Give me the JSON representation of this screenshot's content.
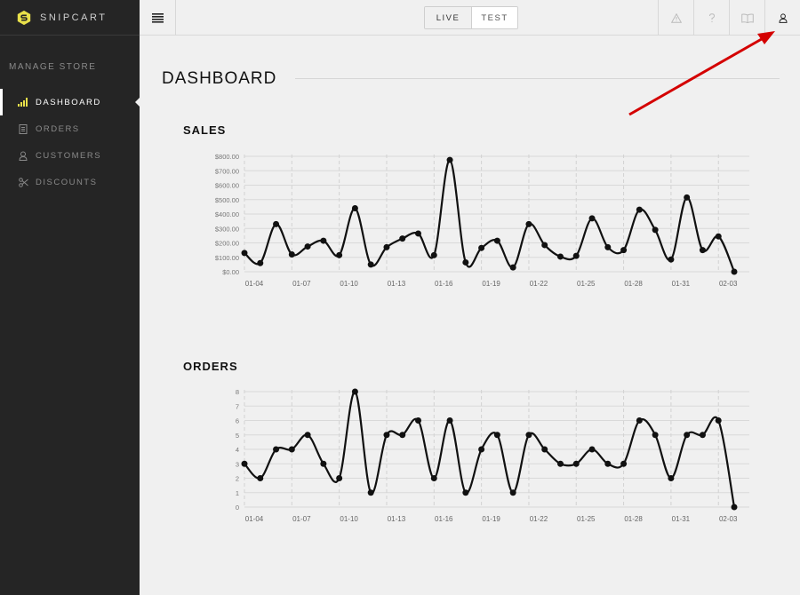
{
  "brand": {
    "name": "SNIPCART"
  },
  "sidebar": {
    "section_title": "MANAGE STORE",
    "items": [
      {
        "label": "DASHBOARD",
        "icon": "bar-chart-icon",
        "active": true
      },
      {
        "label": "ORDERS",
        "icon": "document-icon",
        "active": false
      },
      {
        "label": "CUSTOMERS",
        "icon": "user-icon",
        "active": false
      },
      {
        "label": "DISCOUNTS",
        "icon": "scissors-icon",
        "active": false
      }
    ]
  },
  "topbar": {
    "env_options": [
      "LIVE",
      "TEST"
    ],
    "env_selected": "TEST",
    "icons": [
      "warning-icon",
      "help-icon",
      "book-icon",
      "user-icon"
    ]
  },
  "page": {
    "title": "DASHBOARD"
  },
  "colors": {
    "sidebar_bg": "#252525",
    "accent": "#e8e04a",
    "annotation_arrow": "#d40000"
  },
  "chart_data": [
    {
      "type": "line",
      "title": "SALES",
      "x_ticks": [
        "01-04",
        "01-07",
        "01-10",
        "01-13",
        "01-16",
        "01-19",
        "01-22",
        "01-25",
        "01-28",
        "01-31",
        "02-03"
      ],
      "y_ticks": [
        "$0.00",
        "$100.00",
        "$200.00",
        "$300.00",
        "$400.00",
        "$500.00",
        "$600.00",
        "$700.00",
        "$800.00"
      ],
      "ylim": [
        0,
        800
      ],
      "x": [
        "01-04",
        "01-05",
        "01-06",
        "01-07",
        "01-08",
        "01-09",
        "01-10",
        "01-11",
        "01-12",
        "01-13",
        "01-14",
        "01-15",
        "01-16",
        "01-17",
        "01-18",
        "01-19",
        "01-20",
        "01-21",
        "01-22",
        "01-23",
        "01-24",
        "01-25",
        "01-26",
        "01-27",
        "01-28",
        "01-29",
        "01-30",
        "01-31",
        "02-01",
        "02-02",
        "02-03"
      ],
      "values": [
        130,
        60,
        330,
        120,
        175,
        215,
        115,
        440,
        50,
        170,
        230,
        265,
        115,
        775,
        65,
        165,
        215,
        30,
        330,
        185,
        105,
        110,
        370,
        170,
        150,
        430,
        290,
        85,
        515,
        150,
        245,
        0
      ],
      "grid": true
    },
    {
      "type": "line",
      "title": "ORDERS",
      "x_ticks": [
        "01-04",
        "01-07",
        "01-10",
        "01-13",
        "01-16",
        "01-19",
        "01-22",
        "01-25",
        "01-28",
        "01-31",
        "02-03"
      ],
      "y_ticks": [
        "0",
        "1",
        "2",
        "3",
        "4",
        "5",
        "6",
        "7",
        "8"
      ],
      "ylim": [
        0,
        8
      ],
      "values": [
        3,
        2,
        4,
        4,
        5,
        3,
        2,
        8,
        1,
        5,
        5,
        6,
        2,
        6,
        1,
        4,
        5,
        1,
        5,
        4,
        3,
        3,
        4,
        3,
        3,
        6,
        5,
        2,
        5,
        5,
        6,
        0
      ],
      "grid": true
    }
  ]
}
